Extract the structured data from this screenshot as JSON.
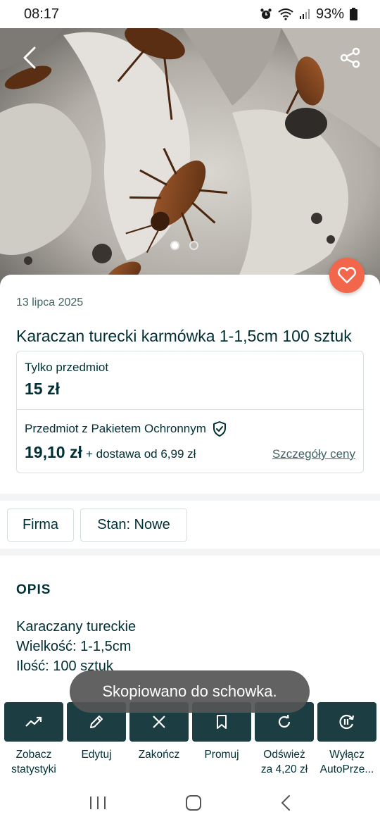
{
  "status_bar": {
    "time": "08:17",
    "battery": "93%"
  },
  "hero": {
    "image_alt": "Karaczan turecki",
    "page_dots": 2,
    "active_dot": 0
  },
  "listing": {
    "date": "13 lipca 2025",
    "title": "Karaczan turecki karmówka 1-1,5cm 100 sztuk",
    "only_item_label": "Tylko przedmiot",
    "only_item_price": "15 zł",
    "protection_label": "Przedmiot z Pakietem Ochronnym",
    "protection_price": "19,10 zł",
    "shipping": "+ dostawa od 6,99 zł",
    "price_details_link": "Szczegóły ceny"
  },
  "tags": [
    "Firma",
    "Stan: Nowe"
  ],
  "description": {
    "heading": "OPIS",
    "lines": [
      "Karaczany tureckie",
      "Wielkość: 1-1,5cm",
      "Ilość: 100 sztuk"
    ]
  },
  "toast": "Skopiowano do schowka.",
  "actions": [
    {
      "label1": "Zobacz",
      "label2": "statystyki",
      "icon": "trend-chart-icon"
    },
    {
      "label1": "Edytuj",
      "label2": "",
      "icon": "pencil-icon"
    },
    {
      "label1": "Zakończ",
      "label2": "",
      "icon": "close-icon"
    },
    {
      "label1": "Promuj",
      "label2": "",
      "icon": "bookmark-icon"
    },
    {
      "label1": "Odśwież",
      "label2": "za 4,20 zł",
      "icon": "refresh-icon"
    },
    {
      "label1": "Wyłącz",
      "label2": "AutoPrze...",
      "icon": "autorenew-pause-icon"
    }
  ],
  "colors": {
    "accent": "#f2664b",
    "dark_teal": "#1c3e43",
    "text": "#002f34"
  }
}
